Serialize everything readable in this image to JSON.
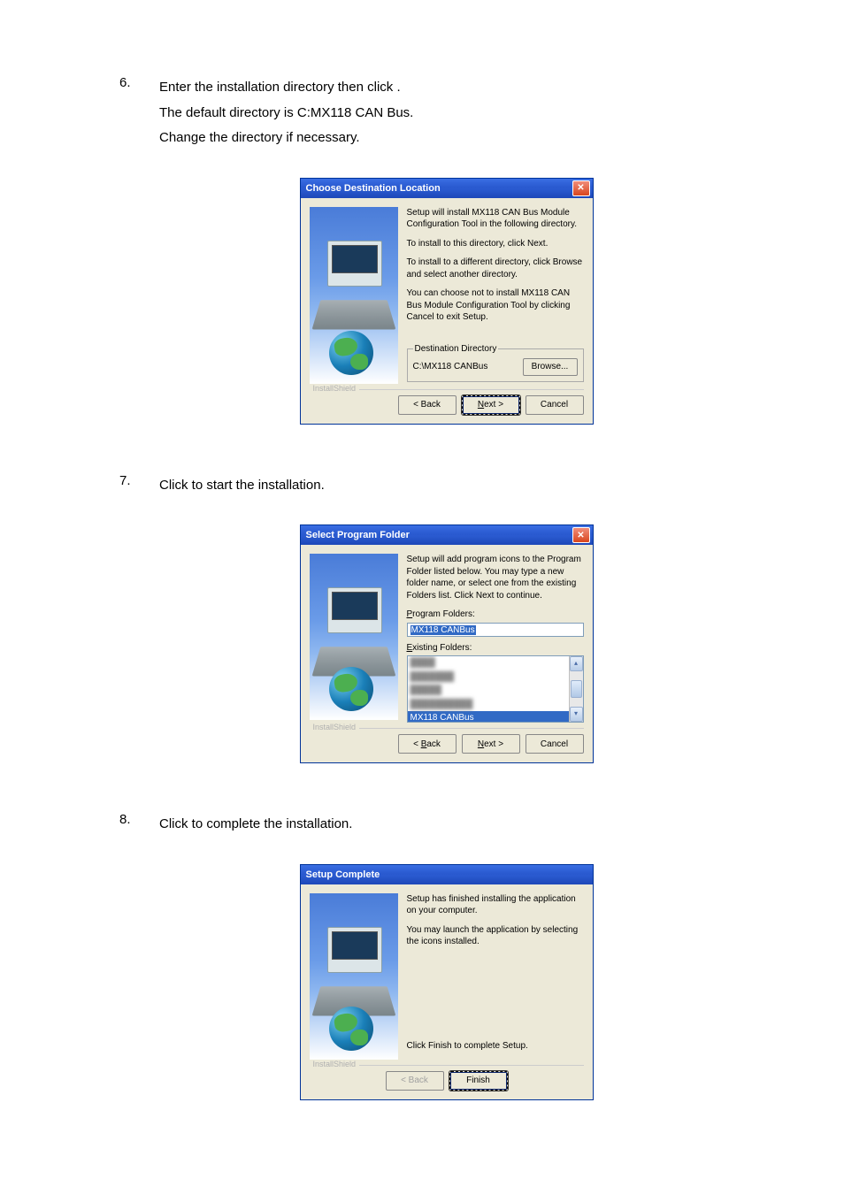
{
  "steps": {
    "s6": {
      "num": "6.",
      "line1": "Enter the installation directory then click        .",
      "line2": "The default directory is C:MX118 CAN Bus.",
      "line3": "Change the directory if necessary."
    },
    "s7": {
      "num": "7.",
      "line1": "Click          to start the installation."
    },
    "s8": {
      "num": "8.",
      "line1": "Click            to complete the installation."
    }
  },
  "dlg_dest": {
    "title": "Choose Destination Location",
    "p1": "Setup will install MX118 CAN Bus Module Configuration Tool in the following directory.",
    "p2": "To install to this directory, click Next.",
    "p3": "To install to a different directory, click Browse and select another directory.",
    "p4": "You can choose not to install MX118 CAN Bus Module Configuration Tool by clicking Cancel to exit Setup.",
    "group_label": "Destination Directory",
    "path": "C:\\MX118 CANBus",
    "browse": "Browse...",
    "brand": "InstallShield",
    "back": "< Back",
    "next": "Next >",
    "cancel": "Cancel"
  },
  "dlg_folder": {
    "title": "Select Program Folder",
    "p1": "Setup will add program icons to the Program Folder listed below. You may type a new folder name, or select one from the existing Folders list.  Click Next to continue.",
    "label1_pre": "P",
    "label1_rest": "rogram Folders:",
    "value": "MX118 CANBus",
    "label2_pre": "E",
    "label2_rest": "xisting Folders:",
    "item_sel": "MX118 CANBus",
    "brand": "InstallShield",
    "back": "< Back",
    "next": "Next >",
    "cancel": "Cancel"
  },
  "dlg_done": {
    "title": "Setup Complete",
    "p1": "Setup has finished installing the application on your computer.",
    "p2": "You may launch the application by selecting the icons installed.",
    "p3": "Click Finish to complete Setup.",
    "brand": "InstallShield",
    "back": "< Back",
    "finish": "Finish"
  }
}
